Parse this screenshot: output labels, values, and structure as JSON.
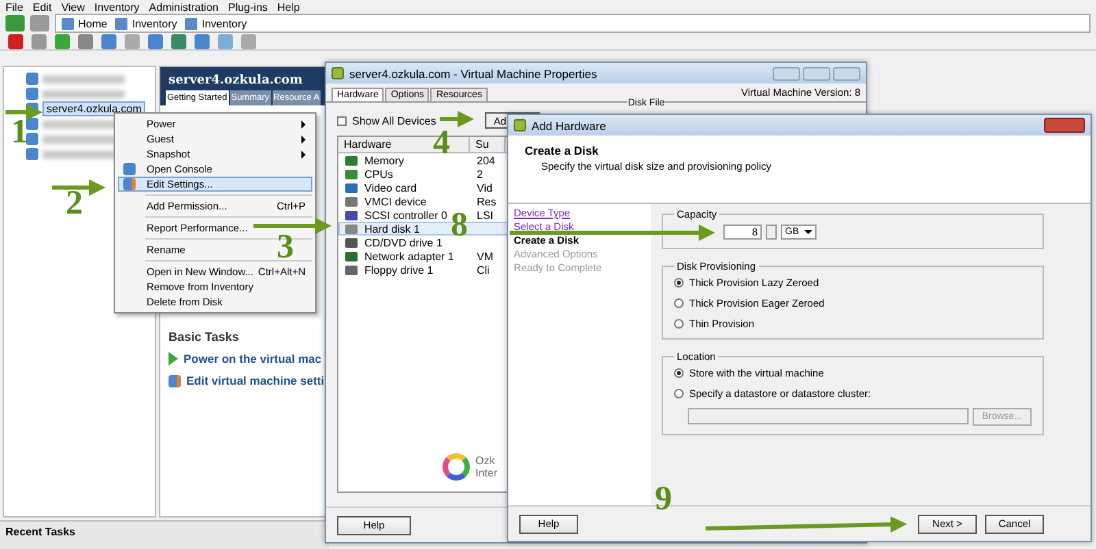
{
  "menu_bar": [
    "File",
    "Edit",
    "View",
    "Inventory",
    "Administration",
    "Plug-ins",
    "Help"
  ],
  "breadcrumb": [
    "Home",
    "Inventory",
    "Inventory"
  ],
  "tree": {
    "items": [
      {
        "kind": "redacted",
        "selected": false
      },
      {
        "kind": "redacted",
        "selected": false
      },
      {
        "kind": "vm",
        "label": "server4.ozkula.com",
        "selected": true
      },
      {
        "kind": "redacted",
        "selected": false
      },
      {
        "kind": "redacted",
        "selected": false
      },
      {
        "kind": "redacted",
        "selected": false
      }
    ]
  },
  "vm_panel": {
    "title": "server4.ozkula.com",
    "tabs": [
      {
        "label": "Getting Started",
        "selected": true
      },
      {
        "label": "Summary",
        "selected": false
      },
      {
        "label": "Resource A",
        "selected": false
      }
    ],
    "basic_tasks": {
      "title": "Basic Tasks",
      "items": [
        {
          "label": "Power on the virtual mac",
          "kind": "power"
        },
        {
          "label": "Edit virtual machine setti",
          "kind": "edit"
        }
      ]
    }
  },
  "context_menu": [
    {
      "kind": "item",
      "label": "Power",
      "submenu": true,
      "highlighted": false
    },
    {
      "kind": "item",
      "label": "Guest",
      "submenu": true,
      "highlighted": false
    },
    {
      "kind": "item",
      "label": "Snapshot",
      "submenu": true,
      "highlighted": false
    },
    {
      "kind": "console",
      "label": "Open Console",
      "submenu": false,
      "highlighted": false
    },
    {
      "kind": "edit",
      "label": "Edit Settings...",
      "submenu": false,
      "highlighted": true
    },
    {
      "kind": "separator"
    },
    {
      "kind": "item",
      "label": "Add Permission...",
      "shortcut": "Ctrl+P",
      "submenu": false,
      "highlighted": false
    },
    {
      "kind": "separator"
    },
    {
      "kind": "item",
      "label": "Report Performance...",
      "submenu": false,
      "highlighted": false
    },
    {
      "kind": "separator"
    },
    {
      "kind": "item",
      "label": "Rename",
      "submenu": false,
      "highlighted": false
    },
    {
      "kind": "separator"
    },
    {
      "kind": "item",
      "label": "Open in New Window...",
      "shortcut": "Ctrl+Alt+N",
      "submenu": false,
      "highlighted": false
    },
    {
      "kind": "item",
      "label": "Remove from Inventory",
      "submenu": false,
      "highlighted": false
    },
    {
      "kind": "item",
      "label": "Delete from Disk",
      "submenu": false,
      "highlighted": false
    }
  ],
  "recent_tasks": {
    "title": "Recent Tasks"
  },
  "vm_properties": {
    "title": "server4.ozkula.com - Virtual Machine Properties",
    "tabs": [
      {
        "label": "Hardware",
        "selected": true
      },
      {
        "label": "Options",
        "selected": false
      },
      {
        "label": "Resources",
        "selected": false
      }
    ],
    "version": "Virtual Machine Version: 8",
    "show_all_devices": {
      "label": "Show All Devices",
      "checked": false
    },
    "add_button": "Ad",
    "disk_file_label": "Disk File",
    "columns": [
      "Hardware",
      "Su"
    ],
    "rows": [
      {
        "kind": "memory",
        "name": "Memory",
        "summary": "204",
        "selected": false
      },
      {
        "kind": "cpu",
        "name": "CPUs",
        "summary": "2",
        "selected": false
      },
      {
        "kind": "video",
        "name": "Video card",
        "summary": "Vid",
        "selected": false
      },
      {
        "kind": "vmci",
        "name": "VMCI device",
        "summary": "Res",
        "selected": false
      },
      {
        "kind": "scsi",
        "name": "SCSI controller 0",
        "summary": "LSI",
        "selected": false
      },
      {
        "kind": "disk",
        "name": "Hard disk 1",
        "selected": true
      },
      {
        "kind": "cdrom",
        "name": "CD/DVD drive 1",
        "selected": false
      },
      {
        "kind": "network",
        "name": "Network adapter 1",
        "summary": "VM",
        "selected": false
      },
      {
        "kind": "floppy",
        "name": "Floppy drive 1",
        "summary": "Cli",
        "selected": false
      }
    ],
    "logo_text": [
      "Ozk",
      "Inter"
    ],
    "help_button": "Help"
  },
  "add_hardware": {
    "title": "Add Hardware",
    "heading": "Create a Disk",
    "subheading": "Specify the virtual disk size and provisioning policy",
    "steps": [
      {
        "label": "Device Type",
        "kind": "done"
      },
      {
        "label": "Select a Disk",
        "kind": "done"
      },
      {
        "label": "Create a Disk",
        "kind": "current"
      },
      {
        "label": "Advanced Options",
        "kind": "pending"
      },
      {
        "label": "Ready to Complete",
        "kind": "pending"
      }
    ],
    "capacity": {
      "title": "Capacity",
      "value": "8",
      "unit": "GB"
    },
    "provisioning": {
      "title": "Disk Provisioning",
      "options": [
        {
          "label": "Thick Provision Lazy Zeroed",
          "selected": true
        },
        {
          "label": "Thick Provision Eager Zeroed",
          "selected": false
        },
        {
          "label": "Thin Provision",
          "selected": false
        }
      ]
    },
    "location": {
      "title": "Location",
      "options": [
        {
          "label": "Store with the virtual machine",
          "selected": true
        },
        {
          "label": "Specify a datastore or datastore cluster:",
          "selected": false
        }
      ],
      "browse_button": "Browse..."
    },
    "help_button": "Help",
    "next_button": "Next >",
    "cancel_button": "Cancel"
  },
  "annotations": [
    "1",
    "2",
    "3",
    "4",
    "8",
    "9"
  ]
}
